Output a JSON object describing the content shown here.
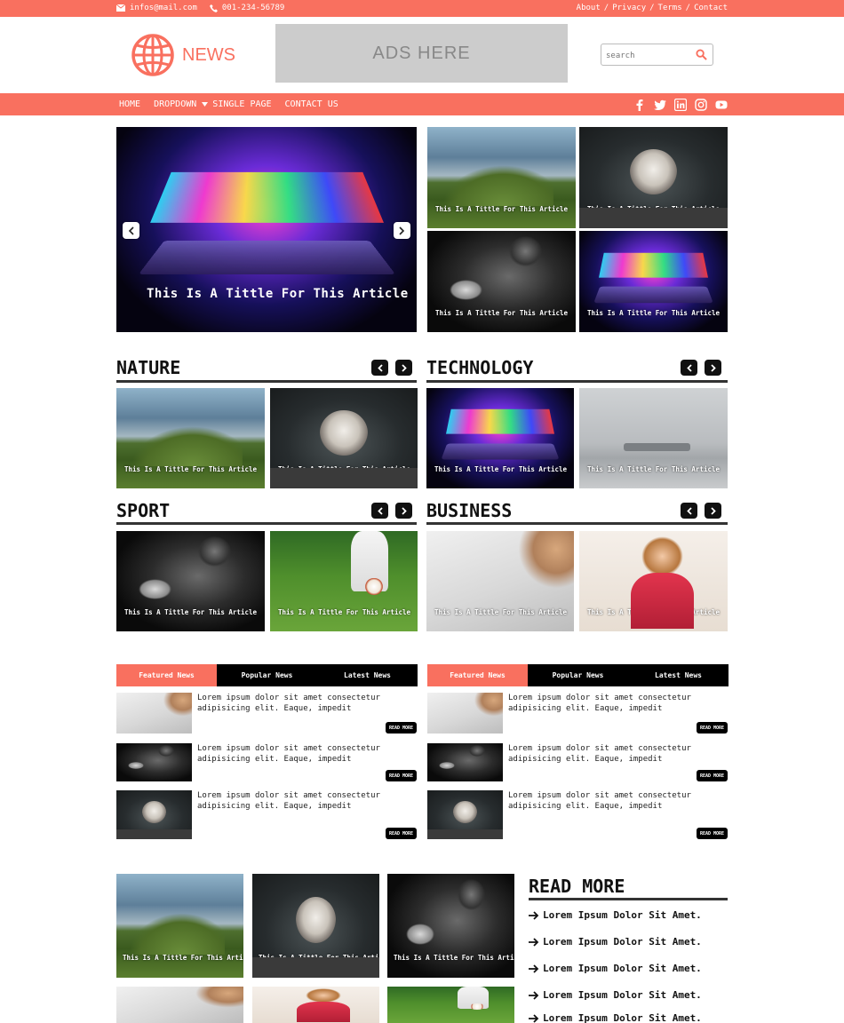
{
  "topbar": {
    "email": "infos@mail.com",
    "phone": "001-234-56789",
    "links": [
      "About",
      "Privacy",
      "Terms",
      "Contact"
    ]
  },
  "header": {
    "logo_text": "NEWS",
    "ads_text": "ADS HERE",
    "search_placeholder": "search"
  },
  "nav": {
    "items": [
      "HOME",
      "DROPDOWN",
      "SINGLE PAGE",
      "CONTACT US"
    ],
    "social": [
      "facebook-icon",
      "twitter-icon",
      "linkedin-icon",
      "instagram-icon",
      "youtube-icon"
    ]
  },
  "hero": {
    "main_title": "This Is A Tittle For This Article",
    "grid": [
      {
        "caption": "This Is A Tittle For This Article",
        "image": "landscape"
      },
      {
        "caption": "This Is A Tittle For This Article",
        "image": "cat"
      },
      {
        "caption": "This Is A Tittle For This Article",
        "image": "boxer"
      },
      {
        "caption": "This Is A Tittle For This Article",
        "image": "laptop"
      }
    ]
  },
  "sections": [
    {
      "title": "NATURE",
      "cards": [
        {
          "caption": "This Is A Tittle For This Article",
          "image": "landscape"
        },
        {
          "caption": "This Is A Tittle For This Article",
          "image": "cat"
        }
      ]
    },
    {
      "title": "TECHNOLOGY",
      "cards": [
        {
          "caption": "This Is A Tittle For This Article",
          "image": "laptop"
        },
        {
          "caption": "This Is A Tittle For This Article",
          "image": "laptops-gray"
        }
      ]
    },
    {
      "title": "SPORT",
      "cards": [
        {
          "caption": "This Is A Tittle For This Article",
          "image": "boxer"
        },
        {
          "caption": "This Is A Tittle For This Article",
          "image": "soccer"
        }
      ]
    },
    {
      "title": "BUSINESS",
      "cards": [
        {
          "caption": "This Is A Tittle For This Article",
          "image": "contract"
        },
        {
          "caption": "This Is A Tittle For This Article",
          "image": "woman"
        }
      ]
    }
  ],
  "tabs": {
    "labels": [
      "Featured News",
      "Popular News",
      "Latest News"
    ],
    "active": "Featured News",
    "item_text": "Lorem ipsum dolor sit amet consectetur adipisicing elit. Eaque, impedit",
    "read_more": "READ MORE"
  },
  "bottom": {
    "caption": "This Is A Tittle For This Article",
    "read_more_title": "READ MORE",
    "read_more_items": [
      "Lorem Ipsum Dolor Sit Amet.",
      "Lorem Ipsum Dolor Sit Amet.",
      "Lorem Ipsum Dolor Sit Amet.",
      "Lorem Ipsum Dolor Sit Amet.",
      "Lorem Ipsum Dolor Sit Amet."
    ]
  },
  "colors": {
    "accent": "#f9705f",
    "dark": "#000000",
    "ads_bg": "#cccccc"
  }
}
